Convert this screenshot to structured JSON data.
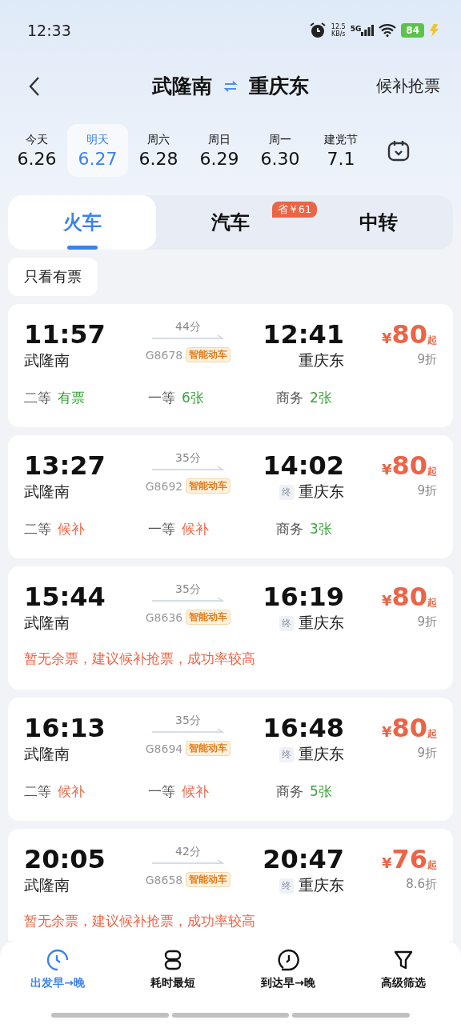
{
  "status_bar": {
    "time": "12:33",
    "net_speed": "12.5",
    "net_unit": "KB/s",
    "network": "5G",
    "battery": "84"
  },
  "header": {
    "from": "武隆南",
    "to": "重庆东",
    "action": "候补抢票"
  },
  "dates": [
    {
      "day": "今天",
      "date": "6.26",
      "selected": false
    },
    {
      "day": "明天",
      "date": "6.27",
      "selected": true
    },
    {
      "day": "周六",
      "date": "6.28",
      "selected": false
    },
    {
      "day": "周日",
      "date": "6.29",
      "selected": false
    },
    {
      "day": "周一",
      "date": "6.30",
      "selected": false
    },
    {
      "day": "建党节",
      "date": "7.1",
      "selected": false
    }
  ],
  "tabs": [
    {
      "label": "火车",
      "selected": true
    },
    {
      "label": "汽车",
      "selected": false,
      "badge": "省￥61"
    },
    {
      "label": "中转",
      "selected": false
    }
  ],
  "filter_chip": {
    "label": "只看有票"
  },
  "trains": [
    {
      "depart": "11:57",
      "from": "武隆南",
      "duration": "44分",
      "number": "G8678",
      "tag": "智能动车",
      "arrive": "12:41",
      "terminal": false,
      "to": "重庆东",
      "price_symbol": "¥",
      "price": "80",
      "price_suffix": "起",
      "discount": "9折",
      "kind": "seats",
      "seats": [
        {
          "class": "二等",
          "status": "有票",
          "available": true
        },
        {
          "class": "一等",
          "status": "6张",
          "available": true
        },
        {
          "class": "商务",
          "status": "2张",
          "available": true
        }
      ]
    },
    {
      "depart": "13:27",
      "from": "武隆南",
      "duration": "35分",
      "number": "G8692",
      "tag": "智能动车",
      "arrive": "14:02",
      "terminal": true,
      "terminal_label": "终",
      "to": "重庆东",
      "price_symbol": "¥",
      "price": "80",
      "price_suffix": "起",
      "discount": "9折",
      "kind": "seats",
      "seats": [
        {
          "class": "二等",
          "status": "候补",
          "available": false
        },
        {
          "class": "一等",
          "status": "候补",
          "available": false
        },
        {
          "class": "商务",
          "status": "3张",
          "available": true
        }
      ]
    },
    {
      "depart": "15:44",
      "from": "武隆南",
      "duration": "35分",
      "number": "G8636",
      "tag": "智能动车",
      "arrive": "16:19",
      "terminal": true,
      "terminal_label": "终",
      "to": "重庆东",
      "price_symbol": "¥",
      "price": "80",
      "price_suffix": "起",
      "discount": "9折",
      "kind": "notice",
      "notice": "暂无余票，建议候补抢票，成功率较高"
    },
    {
      "depart": "16:13",
      "from": "武隆南",
      "duration": "35分",
      "number": "G8694",
      "tag": "智能动车",
      "arrive": "16:48",
      "terminal": true,
      "terminal_label": "终",
      "to": "重庆东",
      "price_symbol": "¥",
      "price": "80",
      "price_suffix": "起",
      "discount": "9折",
      "kind": "seats",
      "seats": [
        {
          "class": "二等",
          "status": "候补",
          "available": false
        },
        {
          "class": "一等",
          "status": "候补",
          "available": false
        },
        {
          "class": "商务",
          "status": "5张",
          "available": true
        }
      ]
    },
    {
      "depart": "20:05",
      "from": "武隆南",
      "duration": "42分",
      "number": "G8658",
      "tag": "智能动车",
      "arrive": "20:47",
      "terminal": true,
      "terminal_label": "终",
      "to": "重庆东",
      "price_symbol": "¥",
      "price": "76",
      "price_suffix": "起",
      "discount": "8.6折",
      "kind": "notice",
      "notice": "暂无余票，建议候补抢票，成功率较高"
    }
  ],
  "bottom_nav": [
    {
      "label": "出发早→晚",
      "kind": "clock",
      "selected": true
    },
    {
      "label": "耗时最短",
      "kind": "hourglass",
      "selected": false
    },
    {
      "label": "到达早→晚",
      "kind": "clock-arrive",
      "selected": false
    },
    {
      "label": "高级筛选",
      "kind": "filter",
      "selected": false
    }
  ]
}
